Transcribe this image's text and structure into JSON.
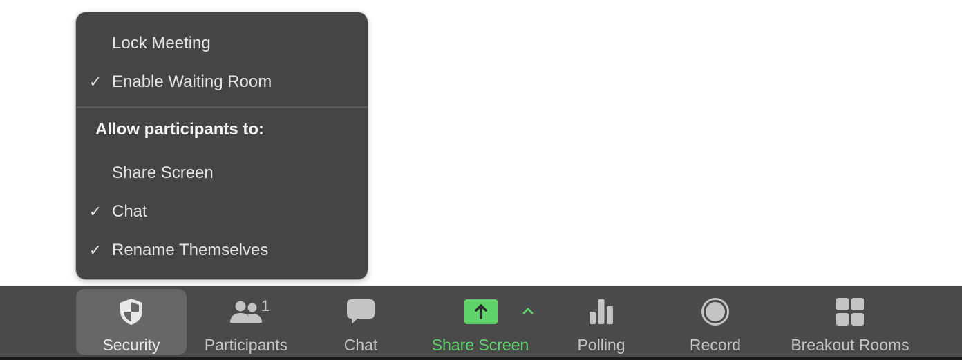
{
  "security_menu": {
    "items": [
      {
        "label": "Lock Meeting",
        "checked": false
      },
      {
        "label": "Enable Waiting Room",
        "checked": true
      }
    ],
    "section_header": "Allow participants to:",
    "participant_items": [
      {
        "label": "Share Screen",
        "checked": false
      },
      {
        "label": "Chat",
        "checked": true
      },
      {
        "label": "Rename Themselves",
        "checked": true
      }
    ],
    "check_glyph": "✓"
  },
  "toolbar": {
    "buttons": [
      {
        "id": "security",
        "label": "Security",
        "icon": "shield-icon",
        "active": true
      },
      {
        "id": "participants",
        "label": "Participants",
        "icon": "participants-icon",
        "count": "1"
      },
      {
        "id": "chat",
        "label": "Chat",
        "icon": "chat-bubble-icon"
      },
      {
        "id": "share-screen",
        "label": "Share Screen",
        "icon": "share-screen-arrow-icon",
        "color": "#5fd46a",
        "caret": "^"
      },
      {
        "id": "polling",
        "label": "Polling",
        "icon": "bar-chart-icon"
      },
      {
        "id": "record",
        "label": "Record",
        "icon": "record-icon"
      },
      {
        "id": "breakout-rooms",
        "label": "Breakout Rooms",
        "icon": "grid-icon"
      }
    ]
  },
  "colors": {
    "menu_bg": "#474543",
    "toolbar_bg": "#4a4a4a",
    "active_button_bg": "#676767",
    "share_green": "#5fd46a",
    "icon_gray": "#c4c4c4"
  }
}
